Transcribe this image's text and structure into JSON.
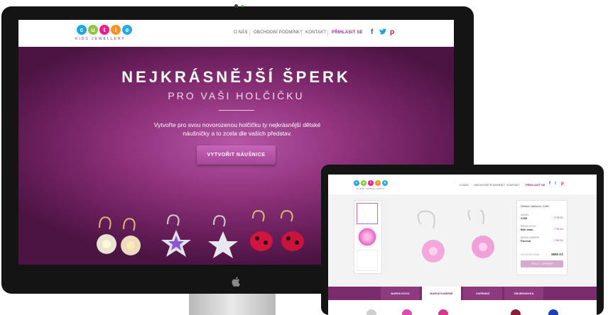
{
  "logo": {
    "letters": [
      "c",
      "u",
      "t",
      "i",
      "e"
    ],
    "colors": [
      "#1ea5e2",
      "#8cc63e",
      "#ec1e8c",
      "#f7931e",
      "#29abe2"
    ],
    "tagline": "KIDS JEWELLERY"
  },
  "nav": {
    "items": [
      "O NÁS",
      "OBCHODNÍ PODMÍNKY",
      "KONTAKT"
    ],
    "login": "PŘIHLÁSIT SE"
  },
  "social": {
    "facebook": "f",
    "twitter": "t",
    "pinterest": "p",
    "colors": {
      "facebook": "#3b5998",
      "twitter": "#1da1f2",
      "pinterest": "#cb2027"
    }
  },
  "hero": {
    "title": "NEJKRÁSNĚJŠÍ ŠPERK",
    "subtitle": "PRO VAŠI HOLČIČKU",
    "text_line1": "Vytvořte pro svou novorozenou holčičku ty nejkrásnější dětské",
    "text_line2": "náušničky a to zcela dle vašich představ.",
    "button": "VYTVOŘIT NÁUŠNICE"
  },
  "laptop": {
    "nav": {
      "items": [
        "O NÁS",
        "OBCHODNÍ PODMÍNKY",
        "KONTAKT"
      ],
      "login": "PŘIHLÁSIT SE"
    },
    "details": {
      "title": "Dětské náušnice 2188",
      "rows": [
        {
          "label": "MODEL",
          "value": "2188",
          "price": "2759 Kč"
        },
        {
          "label": "BARVA KOVU",
          "value": "Bílé zlato",
          "price": "+750 Kč"
        },
        {
          "label": "BARVA KAMENE",
          "value": "Puvová",
          "price": "+250 Kč"
        }
      ],
      "total_label": "CELKOVÁ CENA",
      "total": "3850 Kč",
      "button": "ZVOLIT ZAPÍNÁNÍ"
    },
    "tabs": [
      "BARVA KOVU",
      "BARVA KAMENE",
      "ZAPÍNÁNÍ",
      "OBJEDNÁVKA"
    ],
    "active_tab": 1,
    "gem_colors": [
      "#c9c9c9",
      "#e04ab0",
      "#d33a8d",
      "#8a1f34",
      "#1d3fb5"
    ]
  },
  "colors": {
    "accent": "#9b2f96",
    "hero_dark": "#4b1442",
    "hero_light": "#b458a6"
  }
}
